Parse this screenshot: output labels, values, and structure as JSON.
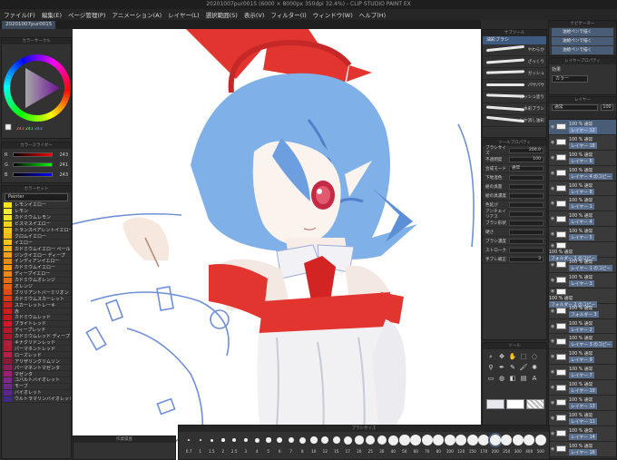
{
  "window": {
    "title": "20201007pur0015 (6000 × 8000px 350dpi 32.4%) - CLIP STUDIO PAINT EX"
  },
  "menu": [
    "ファイル(F)",
    "編集(E)",
    "ページ管理(P)",
    "アニメーション(A)",
    "レイヤー(L)",
    "選択範囲(S)",
    "表示(V)",
    "フィルター(I)",
    "ウィンドウ(W)",
    "ヘルプ(H)"
  ],
  "doc_tab": "20201007pur0015",
  "color_wheel": {
    "title": "カラーサークル",
    "readout": [
      "243",
      "241",
      "243"
    ]
  },
  "color_slider": {
    "title": "カラースライダー",
    "rows": [
      {
        "label": "R",
        "value": "243"
      },
      {
        "label": "G",
        "value": "241"
      },
      {
        "label": "B",
        "value": "243"
      }
    ]
  },
  "color_set": {
    "title": "カラーセット",
    "palette_name": "Painter",
    "items": [
      {
        "name": "レモンイエロー",
        "color": "#f5e61c"
      },
      {
        "name": "レモン",
        "color": "#f4ea3a"
      },
      {
        "name": "カドミウムレモン",
        "color": "#f2e02a"
      },
      {
        "name": "ビスマスイエロー",
        "color": "#f0d419"
      },
      {
        "name": "トランスペアレントイエロー",
        "color": "#eecb1e"
      },
      {
        "name": "クロムイエロー",
        "color": "#f1bd14"
      },
      {
        "name": "イエロー",
        "color": "#f3c51c"
      },
      {
        "name": "カドミウムイエロー ペール",
        "color": "#f2b21a"
      },
      {
        "name": "ジンクイエロー ディープ",
        "color": "#eda01a"
      },
      {
        "name": "インディアンイエロー",
        "color": "#e58c12"
      },
      {
        "name": "カドミウムイエロー",
        "color": "#ee9b14"
      },
      {
        "name": "ディープイエロー",
        "color": "#ea8a12"
      },
      {
        "name": "カドミウムオレンジ",
        "color": "#e66f15"
      },
      {
        "name": "オレンジ",
        "color": "#e35f15"
      },
      {
        "name": "ブリリアントバーミリオン",
        "color": "#df4a14"
      },
      {
        "name": "カドミウムスカーレット",
        "color": "#d93a18"
      },
      {
        "name": "スカーレットレーキ",
        "color": "#c9221f"
      },
      {
        "name": "赤",
        "color": "#d01b1b"
      },
      {
        "name": "カドミウムレッド",
        "color": "#c21a1d"
      },
      {
        "name": "ブライトレッド",
        "color": "#d0182a"
      },
      {
        "name": "ディープレッド",
        "color": "#b8162a"
      },
      {
        "name": "カドミウムレッド ディープ",
        "color": "#a81628"
      },
      {
        "name": "キナクリドンレッド",
        "color": "#b01e3e"
      },
      {
        "name": "パーマネントレッド",
        "color": "#b01a32"
      },
      {
        "name": "ローズレッド",
        "color": "#b42046"
      },
      {
        "name": "アリザリンクリムソン",
        "color": "#8f1a36"
      },
      {
        "name": "パーマネントマゼンタ",
        "color": "#8c1e5a"
      },
      {
        "name": "マゼンタ",
        "color": "#9a1e72"
      },
      {
        "name": "コバルトバイオレット",
        "color": "#7a2a86"
      },
      {
        "name": "モーブ",
        "color": "#6a2a7e"
      },
      {
        "name": "バイオレット",
        "color": "#5a268a"
      },
      {
        "name": "ウルトラマリンバイオレット",
        "color": "#3f2a8a"
      }
    ]
  },
  "sub_tool": {
    "title": "サブツール",
    "active": "油彩ブラシ",
    "brushes": [
      "やわらか",
      "ざっくり",
      "ガッシュ",
      "パサパサ",
      "ガッシュ塗り",
      "水彩ブラシ",
      "ツヤ消し油彩"
    ]
  },
  "tool_property": {
    "title": "ツールプロパティ",
    "rows": [
      "ブラシサイズ",
      "不透明度",
      "合成モード",
      "下地混色",
      "絵の具量",
      "絵の具濃度",
      "色延び",
      "アンチエイリアス",
      "ブラシ形状",
      "硬さ",
      "ブラシ濃度",
      "ストローク",
      "手ブレ補正"
    ],
    "brush_size": "200.0",
    "opacity": "100",
    "blend": "通常",
    "correction": "3"
  },
  "navigator": {
    "title": "ナビゲーター",
    "items": [
      "油絵ペンで描く",
      "油絵ペンで描く",
      "油絵ペンで描く"
    ]
  },
  "layer_property": {
    "title": "レイヤープロパティ",
    "effect": "効果",
    "mode": "カラー"
  },
  "layers": {
    "title": "レイヤー",
    "blend": "通常",
    "opacity": "100",
    "items": [
      {
        "name": "100 % 通常",
        "sub": "レイヤー 12",
        "sel": true
      },
      {
        "name": "100 % 通常",
        "sub": "レイヤー 18",
        "sel": false
      },
      {
        "name": "100 % 通常",
        "sub": "レイヤー 6",
        "sel": false
      },
      {
        "name": "100 % 通常",
        "sub": "レイヤー 4 のコピー",
        "sel": false
      },
      {
        "name": "100 % 通常",
        "sub": "レイヤー 8",
        "sel": false
      },
      {
        "name": "100 % 通常",
        "sub": "レイヤー 1",
        "sel": false
      },
      {
        "name": "100 % 通常",
        "sub": "レイヤー 4",
        "sel": false
      },
      {
        "name": "100 % 通常",
        "sub": "レイヤー 5",
        "sel": false
      },
      {
        "name": "100 % 通常",
        "sub": "フォルダー 1 のコピー",
        "sel": false
      },
      {
        "name": "100 % 通常",
        "sub": "レイヤー 1 のコピー",
        "sel": false
      },
      {
        "name": "100 % 通常",
        "sub": "レイヤー 3",
        "sel": false
      },
      {
        "name": "100 % 通常",
        "sub": "フォルダー 2 のコピー",
        "sel": false
      },
      {
        "name": "100 % 通常",
        "sub": "フォルダー 3",
        "sel": false
      },
      {
        "name": "100 % 通常",
        "sub": "レイヤー 2",
        "sel": false
      },
      {
        "name": "100 % 通常",
        "sub": "レイヤー 3 のコピー",
        "sel": false
      },
      {
        "name": "100 % 通常",
        "sub": "レイヤー 9",
        "sel": false
      },
      {
        "name": "100 % 通常",
        "sub": "レイヤー 7",
        "sel": false
      },
      {
        "name": "100 % 通常",
        "sub": "レイヤー 10",
        "sel": false
      },
      {
        "name": "100 % 通常",
        "sub": "レイヤー 13",
        "sel": false
      },
      {
        "name": "100 % 通常",
        "sub": "レイヤー 11",
        "sel": false
      },
      {
        "name": "100 % 通常",
        "sub": "レイヤー 14",
        "sel": false
      },
      {
        "name": "100 % 通常",
        "sub": "レイヤー 16",
        "sel": false
      }
    ]
  },
  "tool_panel": {
    "title": "ツール"
  },
  "brush_size_panel": {
    "title": "ブラシサイズ",
    "sizes": [
      "0.7",
      "1",
      "1.5",
      "2",
      "2.5",
      "3",
      "4",
      "5",
      "6",
      "7",
      "8",
      "10",
      "12",
      "15",
      "17",
      "20",
      "25",
      "30",
      "40",
      "50",
      "60",
      "70",
      "80",
      "100",
      "120",
      "150",
      "170",
      "200",
      "250",
      "300",
      "400",
      "500"
    ]
  },
  "history_title": "作業履歴",
  "colors": {
    "accent": "#4a5d77",
    "canvas": "#ffffff",
    "hair": "#7fb0e8",
    "ribbon": "#e2352f"
  }
}
